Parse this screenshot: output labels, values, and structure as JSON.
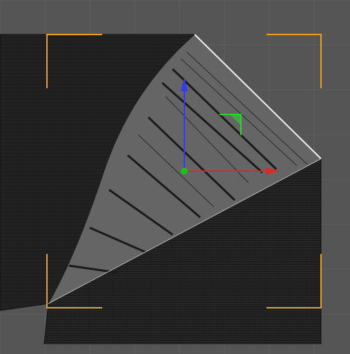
{
  "viewport": {
    "background": "#555555",
    "grid_color": "#5f5f5f",
    "mesh_dark": "#2a2a2a",
    "mesh_line": "#111111",
    "mesh_face": "#656565",
    "edge_highlight": "#f2f2f2",
    "selection_color": "#e8a020"
  },
  "gizmo": {
    "x_axis_color": "#e02828",
    "y_axis_color": "#2e3df0",
    "z_axis_color": "#18c020",
    "plane_handle_color": "#2bd62b",
    "icons": [
      "move-x-arrow-icon",
      "move-y-arrow-icon",
      "move-z-handle-icon",
      "plane-handle-icon"
    ]
  }
}
